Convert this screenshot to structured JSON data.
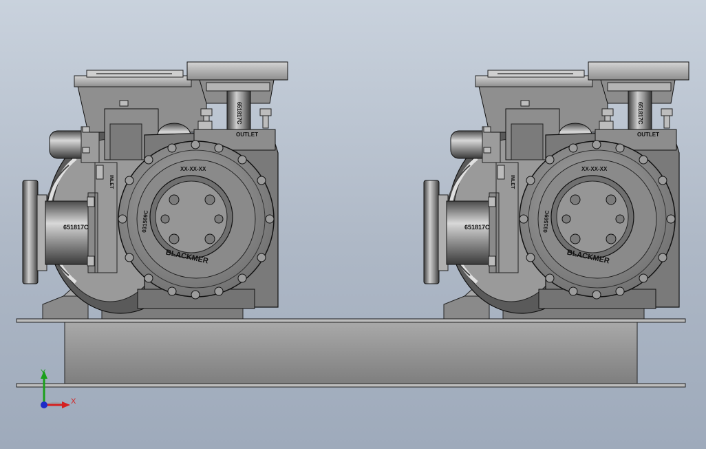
{
  "viewport": {
    "background_top": "#c9d2dd",
    "background_bottom": "#9eaabb"
  },
  "pumps": [
    {
      "inlet_label": "INLET",
      "outlet_label": "OUTLET",
      "code_top": "651817C",
      "code_inlet": "651817C",
      "code_casing": "031569C",
      "casing_mark": "XX-XX-XX",
      "brand": "BLACKMER"
    },
    {
      "inlet_label": "INLET",
      "outlet_label": "OUTLET",
      "code_top": "651817C",
      "code_inlet": "651817C",
      "code_casing": "031569C",
      "casing_mark": "XX-XX-XX",
      "brand": "BLACKMER"
    }
  ],
  "triad": {
    "x_label": "X",
    "y_label": "Y",
    "x_color": "#d42020",
    "y_color": "#1aa01a",
    "z_color": "#1d2cc8"
  }
}
